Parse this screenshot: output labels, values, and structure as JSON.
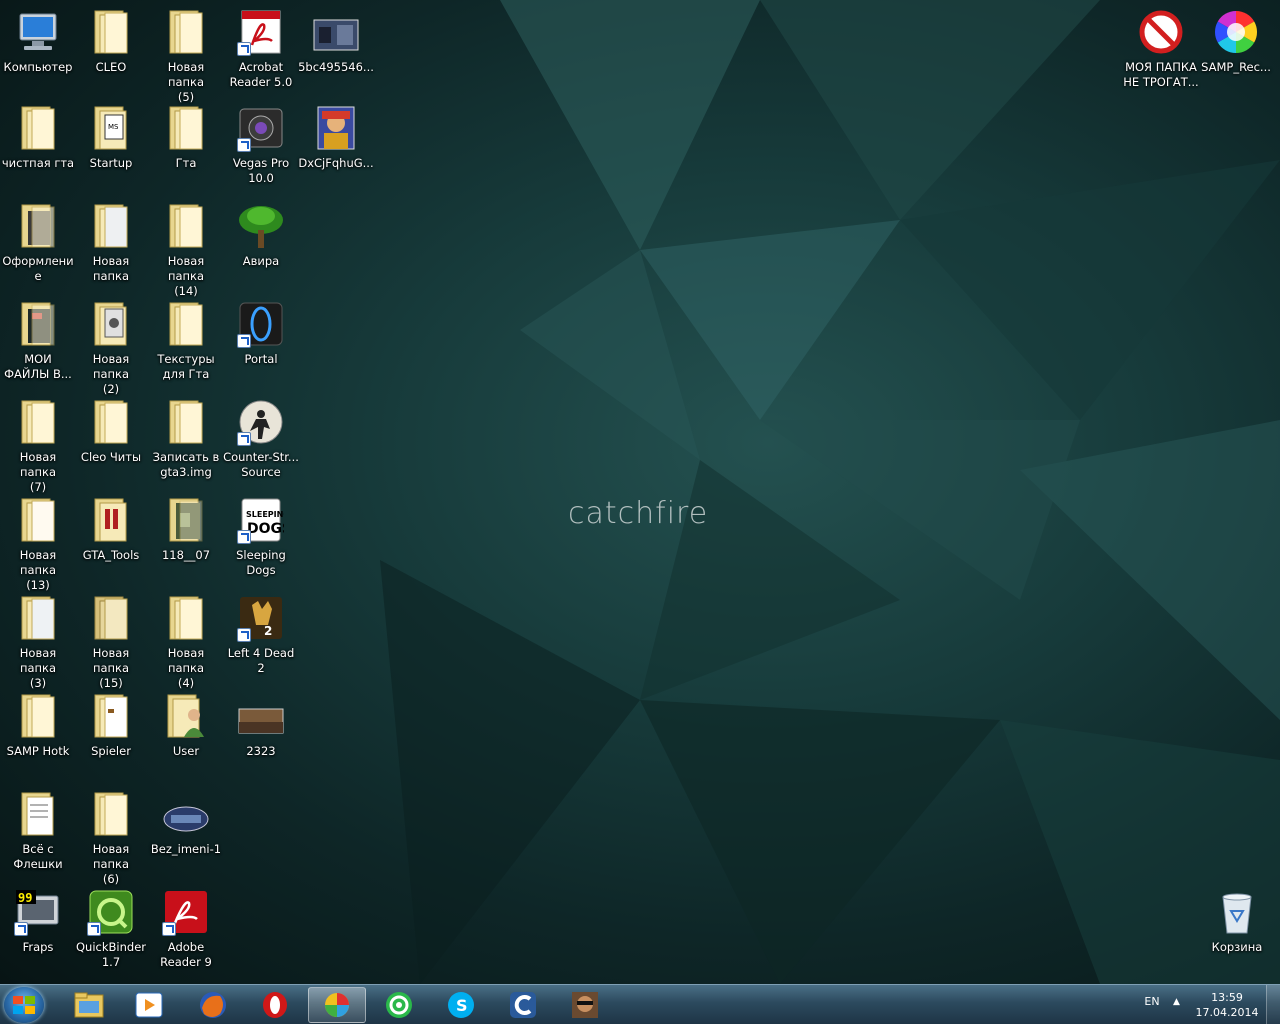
{
  "wallpaper": {
    "brand": "catchfire"
  },
  "desktop": {
    "col1": [
      {
        "label": "Компьютер",
        "icon": "computer-icon"
      },
      {
        "label": "чистпая гта",
        "icon": "folder-icon"
      },
      {
        "label": "Оформлени\nе",
        "icon": "folder-icon"
      },
      {
        "label": "МОИ\nФАЙЛЫ В...",
        "icon": "folder-icon"
      },
      {
        "label": "Новая папка\n(7)",
        "icon": "folder-icon"
      },
      {
        "label": "Новая папка\n(13)",
        "icon": "folder-icon"
      },
      {
        "label": "Новая папка\n(3)",
        "icon": "folder-icon"
      },
      {
        "label": "SAMP Hotk",
        "icon": "folder-icon"
      },
      {
        "label": "Всё с\nФлешки",
        "icon": "folder-icon"
      },
      {
        "label": "Fraps",
        "icon": "fraps-icon"
      }
    ],
    "col2": [
      {
        "label": "CLEO",
        "icon": "folder-icon"
      },
      {
        "label": "Startup",
        "icon": "folder-icon"
      },
      {
        "label": "Новая папка",
        "icon": "folder-icon"
      },
      {
        "label": "Новая папка\n(2)",
        "icon": "folder-icon"
      },
      {
        "label": "Cleo Читы",
        "icon": "folder-icon"
      },
      {
        "label": "GTA_Tools",
        "icon": "folder-icon"
      },
      {
        "label": "Новая папка\n(15)",
        "icon": "folder-icon"
      },
      {
        "label": "Spieler",
        "icon": "folder-icon"
      },
      {
        "label": "Новая папка\n(6)",
        "icon": "folder-icon"
      },
      {
        "label": "QuickBinder\n1.7",
        "icon": "quickbinder-icon"
      }
    ],
    "col3": [
      {
        "label": "Новая папка\n(5)",
        "icon": "folder-icon"
      },
      {
        "label": "Гта",
        "icon": "folder-icon"
      },
      {
        "label": "Новая папка\n(14)",
        "icon": "folder-icon"
      },
      {
        "label": "Текстуры\nдля Гта",
        "icon": "folder-icon"
      },
      {
        "label": "Записать в\ngta3.img",
        "icon": "folder-icon"
      },
      {
        "label": "118__07",
        "icon": "folder-icon"
      },
      {
        "label": "Новая папка\n(4)",
        "icon": "folder-icon"
      },
      {
        "label": "User",
        "icon": "user-folder-icon"
      },
      {
        "label": "Bez_imeni-1",
        "icon": "image-icon"
      },
      {
        "label": "Adobe\nReader 9",
        "icon": "adobe-reader-icon"
      }
    ],
    "col4": [
      {
        "label": "Acrobat\nReader 5.0",
        "icon": "acrobat-icon"
      },
      {
        "label": "Vegas Pro\n10.0",
        "icon": "vegas-icon"
      },
      {
        "label": "Авира",
        "icon": "avira-tree-icon"
      },
      {
        "label": "Portal",
        "icon": "portal-icon"
      },
      {
        "label": "Counter-Str...\nSource",
        "icon": "counter-strike-icon"
      },
      {
        "label": "Sleeping\nDogs",
        "icon": "sleeping-dogs-icon"
      },
      {
        "label": "Left 4 Dead 2",
        "icon": "left4dead-icon"
      },
      {
        "label": "2323",
        "icon": "image-icon"
      }
    ],
    "col5": [
      {
        "label": "5bc495546...",
        "icon": "image-icon"
      },
      {
        "label": "DxCjFqhuG...",
        "icon": "image-icon"
      }
    ],
    "top_right": [
      {
        "label": "МОЯ ПАПКА\nНЕ ТРОГАТ...",
        "icon": "no-entry-icon"
      },
      {
        "label": "SAMP_Rec...",
        "icon": "color-wheel-icon"
      }
    ],
    "recycle_bin": {
      "label": "Корзина",
      "icon": "recycle-bin-icon"
    }
  },
  "taskbar": {
    "items": [
      {
        "name": "explorer",
        "icon": "explorer-icon"
      },
      {
        "name": "media-player",
        "icon": "media-player-icon"
      },
      {
        "name": "firefox",
        "icon": "firefox-icon"
      },
      {
        "name": "opera",
        "icon": "opera-icon"
      },
      {
        "name": "color-app",
        "icon": "color-app-icon",
        "active": true
      },
      {
        "name": "mail-agent",
        "icon": "mail-agent-icon"
      },
      {
        "name": "skype",
        "icon": "skype-icon"
      },
      {
        "name": "ccleaner",
        "icon": "ccleaner-icon"
      },
      {
        "name": "game",
        "icon": "game-avatar-icon"
      }
    ],
    "tray": {
      "lang": "EN",
      "time": "13:59",
      "date": "17.04.2014"
    }
  }
}
